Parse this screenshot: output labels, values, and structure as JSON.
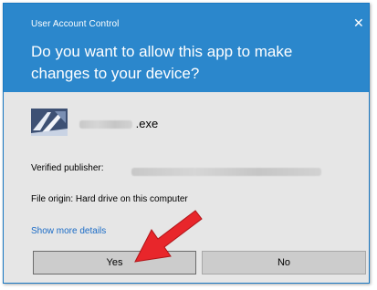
{
  "window": {
    "title": "User Account Control",
    "close_glyph": "✕"
  },
  "dialog": {
    "question": "Do you want to allow this app to make changes to your device?",
    "app": {
      "icon": "app-installer-icon",
      "file_extension": ".exe"
    },
    "publisher_label": "Verified publisher:",
    "file_origin": "File origin: Hard drive on this computer",
    "show_more_details": "Show more details"
  },
  "buttons": {
    "yes": "Yes",
    "no": "No"
  },
  "annotation": {
    "icon": "red-arrow-pointer-icon",
    "color": "#e8262b"
  },
  "colors": {
    "header": "#2b87cc",
    "body": "#e6e6e6",
    "link": "#1a6bc6",
    "button": "#cccccc"
  }
}
